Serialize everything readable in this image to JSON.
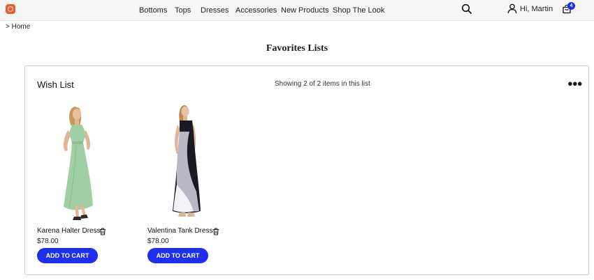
{
  "header": {
    "logo": "brand-logo",
    "nav": [
      "Bottoms",
      "Tops",
      "Dresses",
      "Accessories",
      "New Products",
      "Shop The Look"
    ],
    "greeting": "Hi, Martin",
    "cart_count": "4"
  },
  "breadcrumb": "> Home",
  "page_title": "Favorites Lists",
  "list": {
    "title": "Wish List",
    "count_text": "Showing 2 of 2 items in this list",
    "items": [
      {
        "name": "Karena Halter Dress",
        "price": "$78.00",
        "button": "ADD TO CART"
      },
      {
        "name": "Valentina Tank Dress",
        "price": "$78.00",
        "button": "ADD TO CART"
      }
    ]
  },
  "colors": {
    "accent": "#1f2ff0",
    "logo": "#ef5a2b",
    "topbar": "#f6f6f6"
  }
}
